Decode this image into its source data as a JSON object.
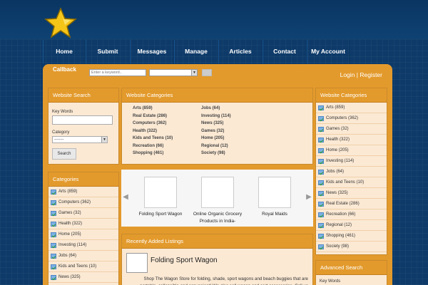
{
  "nav": [
    "Home",
    "Submit",
    "Messages",
    "Manage",
    "Articles",
    "Contact",
    "My Account"
  ],
  "bar": {
    "callback": "Callback",
    "keyword_placeholder": "Enter a keyword..",
    "login": "Login",
    "separator": " | ",
    "register": "Register"
  },
  "left_search": {
    "title": "Website Search",
    "keywords_label": "Key Words",
    "category_label": "Category",
    "category_value": "--------",
    "button": "Search"
  },
  "left_categories": {
    "title": "Categories",
    "items": [
      "Arts (859)",
      "Computers (362)",
      "Games (32)",
      "Health (322)",
      "Home (205)",
      "Investing (114)",
      "Jobs (64)",
      "Kids and Teens (10)",
      "News (325)"
    ]
  },
  "center_categories": {
    "title": "Website Categories",
    "col1": [
      "Arts (859)",
      "Real Estate (286)",
      "Computers (362)",
      "Health (322)",
      "Kids and Teens (10)",
      "Recreation (66)",
      "Shopping (461)"
    ],
    "col2": [
      "Jobs (64)",
      "Investing (114)",
      "News (325)",
      "Games (32)",
      "Home (205)",
      "Regional (12)",
      "Society (98)"
    ]
  },
  "featured": [
    {
      "line1": "Folding Sport Wagon",
      "line2": ""
    },
    {
      "line1": "Online Organic Grocery",
      "line2": "Products in India-"
    },
    {
      "line1": "Royal Maids",
      "line2": ""
    }
  ],
  "recent": {
    "title": "Recently Added Listings",
    "item_title": "Folding Sport Wagon",
    "item_desc": "Shop The Wagon Store for folding, shade, sport wagons and beach buggies that are portable, collapsible and convenient! We also sell wagon and cart accessories. Call us"
  },
  "right_categories": {
    "title": "Website Categories",
    "items": [
      "Arts (859)",
      "Computers (362)",
      "Games (32)",
      "Health (322)",
      "Home (205)",
      "Investing (114)",
      "Jobs (64)",
      "Kids and Teens (10)",
      "News (325)",
      "Real Estate (286)",
      "Recreation (66)",
      "Regional (12)",
      "Shopping (461)",
      "Society (98)"
    ]
  },
  "advanced": {
    "title": "Advanced Search",
    "keywords_label": "Key Words"
  },
  "colors": {
    "background": "#0d3a69",
    "accent": "#e39a2c",
    "panel": "#fbe9d4"
  }
}
